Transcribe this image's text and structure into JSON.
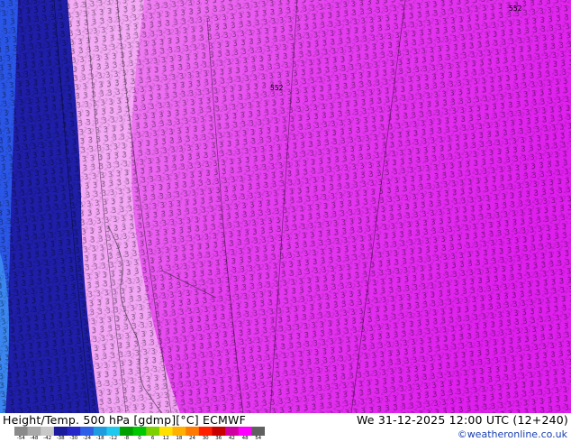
{
  "product": {
    "title": "Height/Temp. 500 hPa [gdmp][°C] ECMWF",
    "valid_time": "We 31-12-2025 12:00 UTC (12+240)",
    "credit": "©weatheronline.co.uk"
  },
  "legend": {
    "ticks": [
      "-54",
      "-48",
      "-42",
      "-38",
      "-30",
      "-24",
      "-18",
      "-12",
      "-8",
      "0",
      "6",
      "12",
      "18",
      "24",
      "30",
      "36",
      "42",
      "48",
      "54"
    ],
    "colors": [
      "#8a8a8a",
      "#a9a9a9",
      "#c8c8c8",
      "#1b1b9c",
      "#2525c8",
      "#2f5fe6",
      "#1f9be0",
      "#20c8ee",
      "#00a000",
      "#00c800",
      "#7ed000",
      "#ffe000",
      "#ffb000",
      "#ff7a00",
      "#ff2000",
      "#c80000",
      "#d000a0",
      "#ff00ff",
      "#606060"
    ]
  },
  "map": {
    "colors": {
      "deep_blue": "#1e1ea8",
      "mid_blue": "#2a56e8",
      "light_blue": "#3a86f0",
      "pale_magenta": "#f3a5f4",
      "magenta": "#e83cf0",
      "bright_magenta": "#e010ee",
      "contour": "#000000"
    },
    "contour_label_value": "552"
  }
}
